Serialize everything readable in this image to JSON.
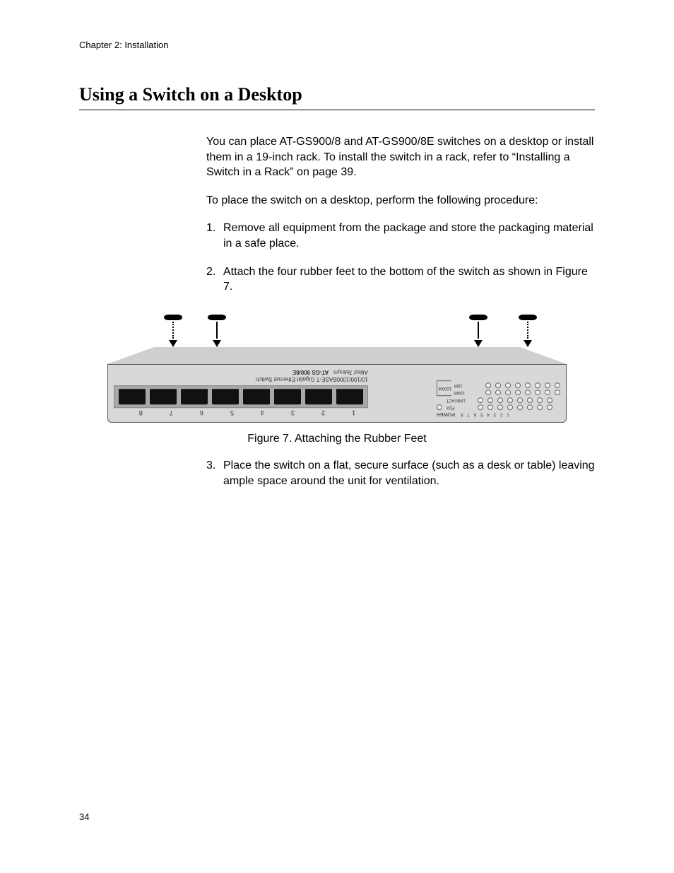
{
  "header": {
    "chapter": "Chapter 2: Installation"
  },
  "section": {
    "title": "Using a Switch on a Desktop"
  },
  "body": {
    "intro": "You can place AT-GS900/8 and AT-GS900/8E switches on a desktop or install them in a 19-inch rack. To install the switch in a rack, refer to “Installing a Switch in a Rack” on page 39.",
    "lead": "To place the switch on a desktop, perform the following procedure:",
    "steps": {
      "s1_num": "1.",
      "s1_text": "Remove all equipment from the package and store the packaging material in a safe place.",
      "s2_num": "2.",
      "s2_text": "Attach the four rubber feet to the bottom of the switch as shown in Figure 7.",
      "s3_num": "3.",
      "s3_text": "Place the switch on a flat, secure surface (such as a desk or table) leaving ample space around the unit for ventilation."
    }
  },
  "figure": {
    "caption": "Figure 7. Attaching the Rubber Feet",
    "port_numbers": [
      "8",
      "7",
      "6",
      "5",
      "4",
      "3",
      "2",
      "1"
    ],
    "model_line1": "10/100/1000BASE-T Gigabit Ethernet Switch",
    "model_brand": "Allied Telesyn",
    "model_name": "AT-GS 900/8E",
    "led_power": "POWER",
    "led_nums": [
      "1",
      "2",
      "3",
      "4",
      "5",
      "6",
      "7",
      "8"
    ],
    "led_rows": {
      "fdx": "FDX",
      "linkact": "LINK/ACT",
      "m100": "100M",
      "m10": "10M",
      "m1000": "1000M"
    }
  },
  "page_number": "34"
}
